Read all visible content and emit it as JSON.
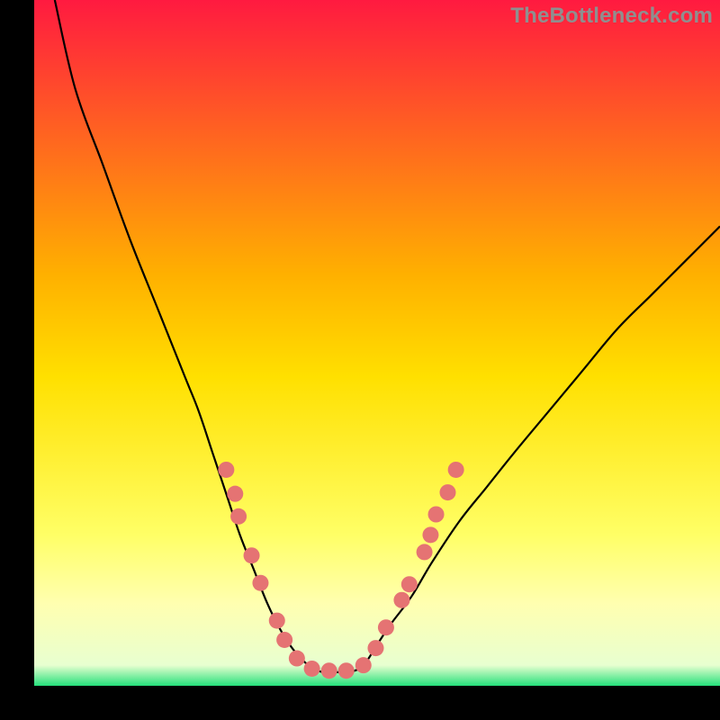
{
  "watermark": "TheBottleneck.com",
  "chart_data": {
    "type": "line",
    "title": "",
    "xlabel": "",
    "ylabel": "",
    "xlim": [
      0,
      100
    ],
    "ylim": [
      0,
      100
    ],
    "grid": false,
    "legend": false,
    "gradient_stops": [
      {
        "offset": 0,
        "color": "#ff1a40"
      },
      {
        "offset": 40,
        "color": "#ffb000"
      },
      {
        "offset": 55,
        "color": "#ffe000"
      },
      {
        "offset": 78,
        "color": "#ffff66"
      },
      {
        "offset": 88,
        "color": "#ffffb0"
      },
      {
        "offset": 97,
        "color": "#e8ffd0"
      },
      {
        "offset": 100,
        "color": "#25e07b"
      }
    ],
    "series": [
      {
        "name": "left-curve",
        "comment": "V-shaped curve left branch; x in percent across plot, y in percent (0=top,100=bottom) approximate readings",
        "x": [
          3,
          6,
          10,
          14,
          18,
          22,
          24,
          26,
          28,
          30,
          32,
          34,
          36,
          38,
          40
        ],
        "y": [
          0,
          13,
          24,
          35,
          45,
          55,
          60,
          66,
          72,
          78,
          83,
          88,
          92,
          95,
          97
        ]
      },
      {
        "name": "flat-bottom",
        "x": [
          40,
          42,
          44,
          46,
          48
        ],
        "y": [
          97,
          98,
          98,
          98,
          97
        ]
      },
      {
        "name": "right-curve",
        "x": [
          48,
          50,
          52,
          55,
          58,
          62,
          66,
          70,
          75,
          80,
          85,
          90,
          95,
          100
        ],
        "y": [
          97,
          94,
          91,
          87,
          82,
          76,
          71,
          66,
          60,
          54,
          48,
          43,
          38,
          33
        ]
      }
    ],
    "markers": {
      "name": "dots",
      "comment": "salmon circular markers near bottom of V; x,y in percent of plot area",
      "color": "#e57373",
      "radius": 9,
      "points": [
        {
          "x": 28.0,
          "y": 68.5
        },
        {
          "x": 29.3,
          "y": 72.0
        },
        {
          "x": 29.8,
          "y": 75.3
        },
        {
          "x": 31.7,
          "y": 81.0
        },
        {
          "x": 33.0,
          "y": 85.0
        },
        {
          "x": 35.4,
          "y": 90.5
        },
        {
          "x": 36.5,
          "y": 93.3
        },
        {
          "x": 38.3,
          "y": 96.0
        },
        {
          "x": 40.5,
          "y": 97.5
        },
        {
          "x": 43.0,
          "y": 97.8
        },
        {
          "x": 45.5,
          "y": 97.8
        },
        {
          "x": 48.0,
          "y": 97.0
        },
        {
          "x": 49.8,
          "y": 94.5
        },
        {
          "x": 51.3,
          "y": 91.5
        },
        {
          "x": 53.6,
          "y": 87.5
        },
        {
          "x": 54.7,
          "y": 85.2
        },
        {
          "x": 56.9,
          "y": 80.5
        },
        {
          "x": 57.8,
          "y": 78.0
        },
        {
          "x": 58.6,
          "y": 75.0
        },
        {
          "x": 60.3,
          "y": 71.8
        },
        {
          "x": 61.5,
          "y": 68.5
        }
      ]
    }
  }
}
